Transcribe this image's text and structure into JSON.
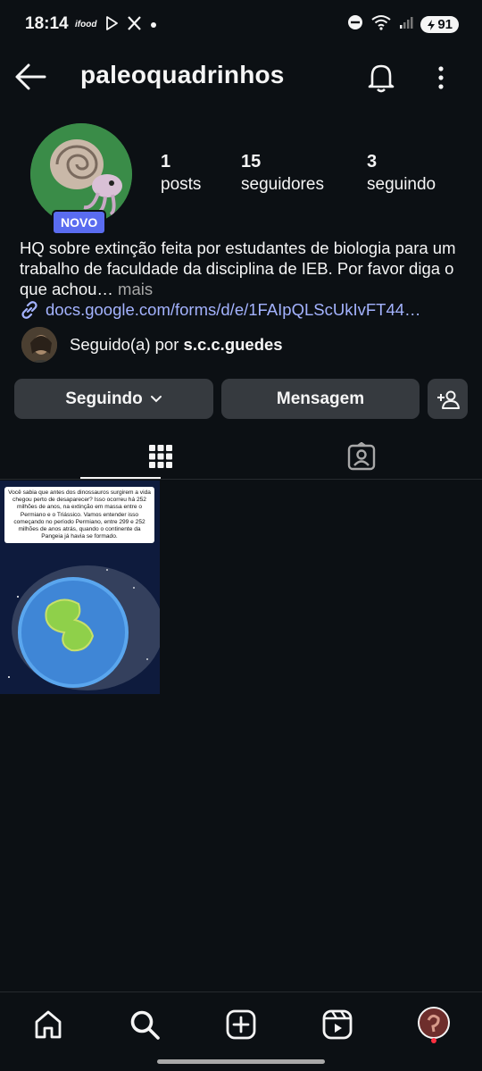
{
  "status_bar": {
    "time": "18:14",
    "left_icons": [
      "ifood",
      "play-store-icon",
      "x-icon",
      "dot-icon"
    ],
    "ifood_label": "ifood",
    "battery": "91"
  },
  "header": {
    "username": "paleoquadrinhos"
  },
  "profile": {
    "badge": "NOVO",
    "stats": [
      {
        "value": "1",
        "label": "posts"
      },
      {
        "value": "15",
        "label": "seguidores"
      },
      {
        "value": "3",
        "label": "seguindo"
      }
    ],
    "bio_text": "HQ sobre extinção feita por estudantes de biologia para um trabalho de faculdade da disciplina de IEB. Por favor diga o que achou…",
    "bio_more": " mais",
    "link": "docs.google.com/forms/d/e/1FAIpQLScUkIvFT44…",
    "followed_by_prefix": "Seguido(a) por ",
    "followed_by_name": "s.c.c.guedes"
  },
  "actions": {
    "following": "Seguindo",
    "message": "Mensagem"
  },
  "post": {
    "text": "Você sabia que antes dos dinossauros surgirem a vida chegou perto de desaparecer? Isso ocorreu há 252 milhões de anos, na extinção em massa entre o Permiano e o Triássico. Vamos entender isso começando no período Permiano, entre 299 e 252 milhões de anos atrás, quando o continente da Pangeia já havia se formado."
  },
  "colors": {
    "background": "#0c1014",
    "button": "#363a3f",
    "link": "#a4b3ff",
    "badge": "#5a6cf0"
  }
}
